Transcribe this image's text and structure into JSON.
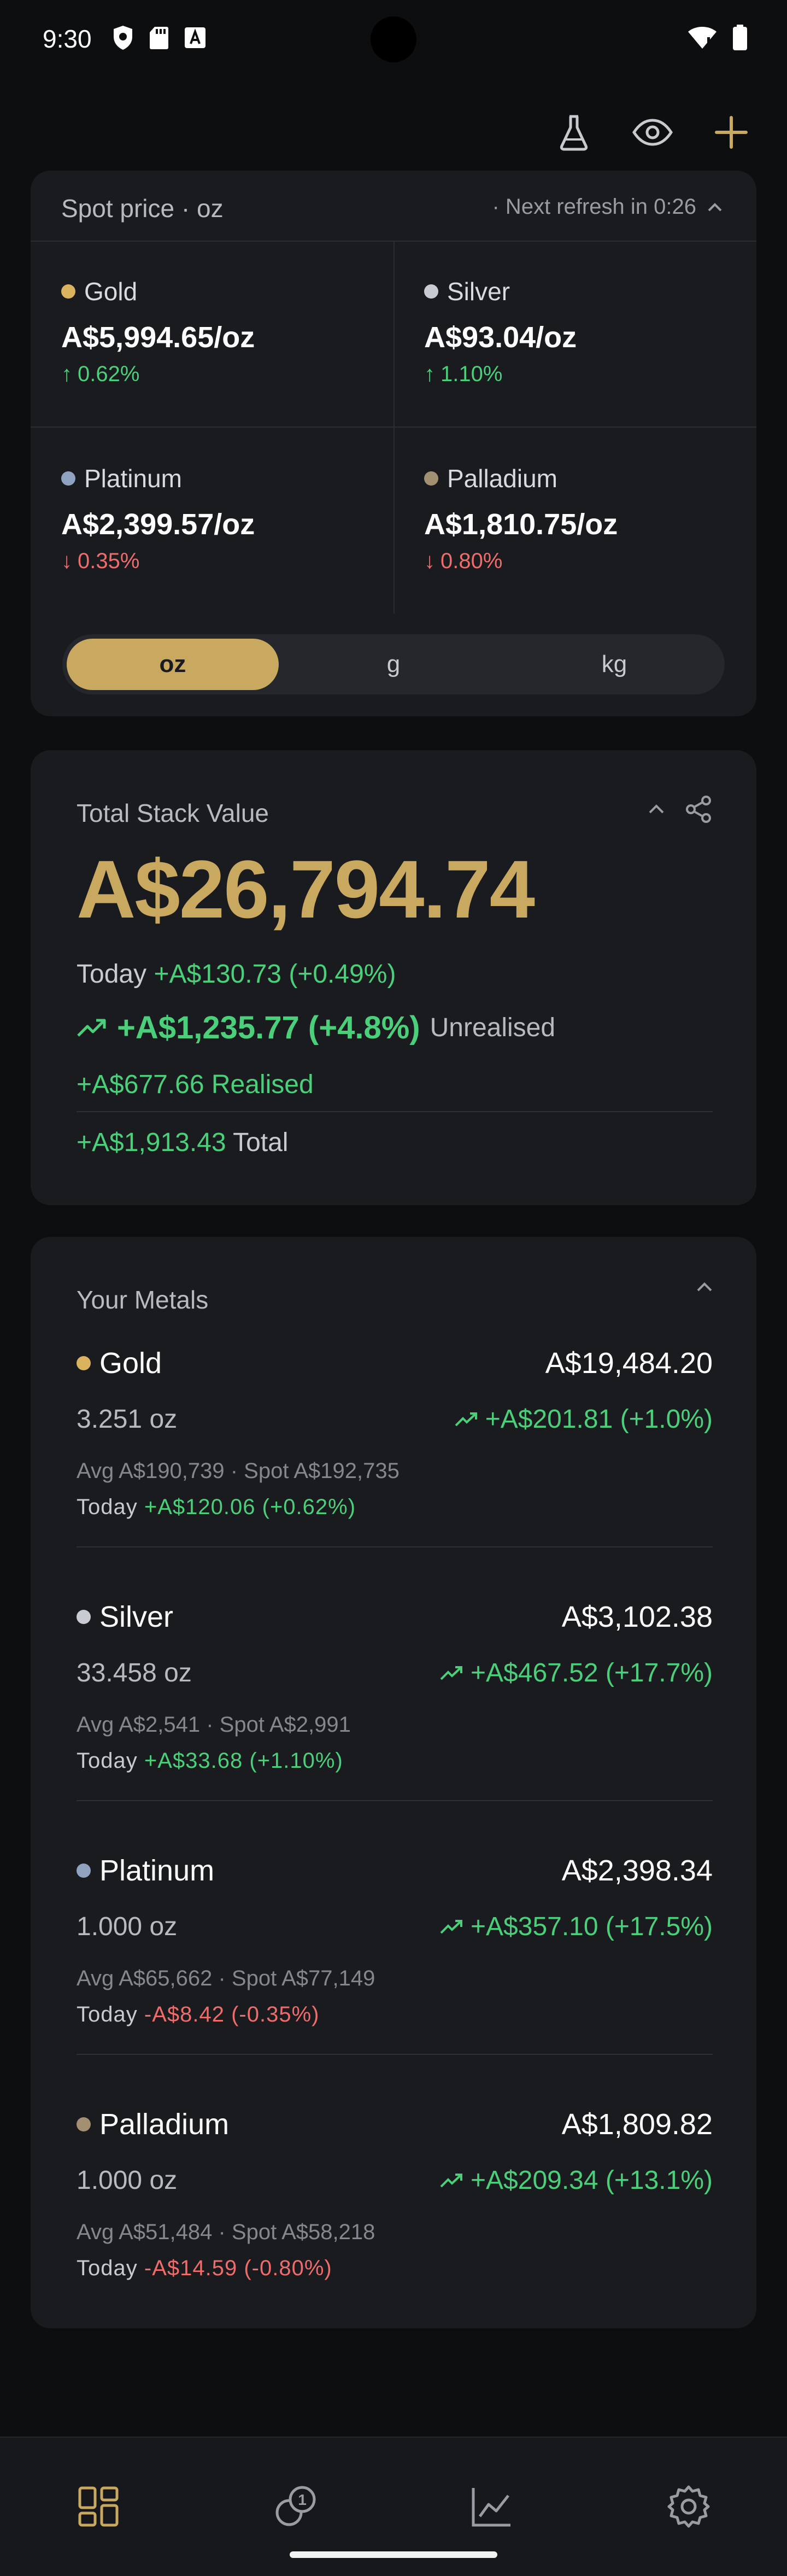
{
  "status_bar": {
    "time": "9:30"
  },
  "colors": {
    "accent": "#c9a95f",
    "up": "#4bcf7a",
    "down": "#ef6c6c",
    "gold_dot": "#d9b35e",
    "silver_dot": "#c8cbd1",
    "platinum_dot": "#8fa3c0",
    "palladium_dot": "#a38f72"
  },
  "top_actions": {
    "icons": [
      "flask-icon",
      "eye-icon",
      "plus-icon"
    ]
  },
  "spot": {
    "title": "Spot price · oz",
    "refresh": "· Next refresh in 0:26",
    "metals": [
      {
        "name": "Gold",
        "price": "A$5,994.65/oz",
        "change": "0.62%",
        "direction": "up"
      },
      {
        "name": "Silver",
        "price": "A$93.04/oz",
        "change": "1.10%",
        "direction": "up"
      },
      {
        "name": "Platinum",
        "price": "A$2,399.57/oz",
        "change": "0.35%",
        "direction": "down"
      },
      {
        "name": "Palladium",
        "price": "A$1,810.75/oz",
        "change": "0.80%",
        "direction": "down"
      }
    ],
    "units": [
      "oz",
      "g",
      "kg"
    ],
    "selected_unit": "oz"
  },
  "total": {
    "label": "Total Stack Value",
    "value": "A$26,794.74",
    "today_label": "Today",
    "today_value": "+A$130.73 (+0.49%)",
    "unrealised_value": "+A$1,235.77 (+4.8%)",
    "unrealised_label": "Unrealised",
    "realised": "+A$677.66 Realised",
    "total_value": "+A$1,913.43",
    "total_label": "Total"
  },
  "metals": {
    "title": "Your Metals",
    "today_label": "Today",
    "items": [
      {
        "name": "Gold",
        "value": "A$19,484.20",
        "qty": "3.251 oz",
        "gain": "+A$201.81 (+1.0%)",
        "avg": "Avg A$190,739 · Spot A$192,735",
        "today": "+A$120.06 (+0.62%)",
        "today_dir": "up"
      },
      {
        "name": "Silver",
        "value": "A$3,102.38",
        "qty": "33.458 oz",
        "gain": "+A$467.52 (+17.7%)",
        "avg": "Avg A$2,541 · Spot A$2,991",
        "today": "+A$33.68 (+1.10%)",
        "today_dir": "up"
      },
      {
        "name": "Platinum",
        "value": "A$2,398.34",
        "qty": "1.000 oz",
        "gain": "+A$357.10 (+17.5%)",
        "avg": "Avg A$65,662 · Spot A$77,149",
        "today": "-A$8.42 (-0.35%)",
        "today_dir": "down"
      },
      {
        "name": "Palladium",
        "value": "A$1,809.82",
        "qty": "1.000 oz",
        "gain": "+A$209.34 (+13.1%)",
        "avg": "Avg A$51,484 · Spot A$58,218",
        "today": "-A$14.59 (-0.80%)",
        "today_dir": "down"
      }
    ]
  },
  "bottom_nav": {
    "items": [
      "dashboard-icon",
      "coins-icon",
      "chart-icon",
      "settings-icon"
    ],
    "active": 0
  }
}
